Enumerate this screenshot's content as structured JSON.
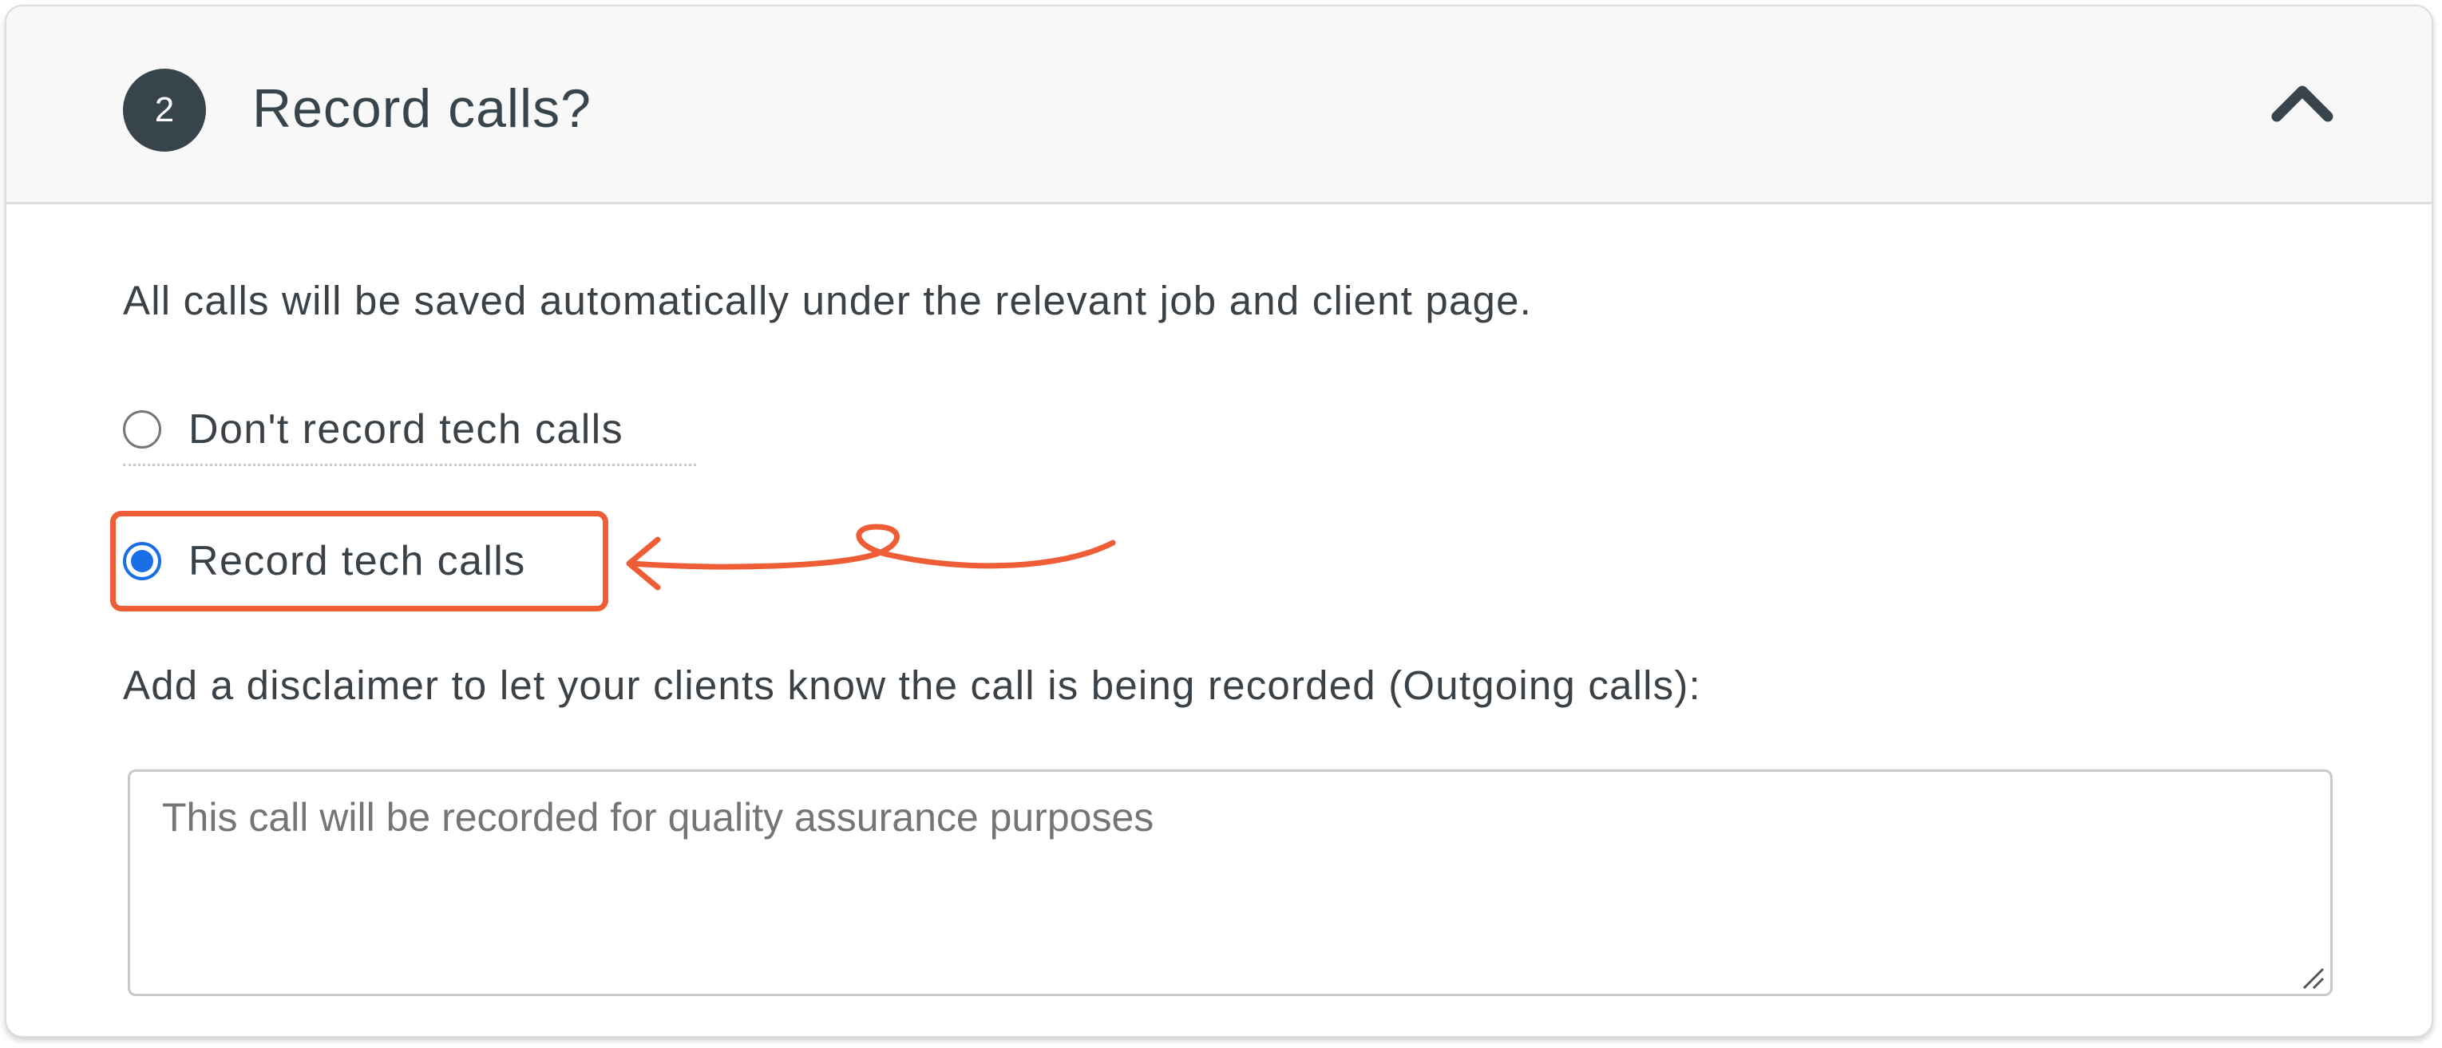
{
  "section": {
    "step_number": "2",
    "title": "Record calls?",
    "expanded": true
  },
  "intro_text": "All calls will be saved automatically under the relevant job and client page.",
  "options": [
    {
      "label": "Don't record tech calls",
      "selected": false
    },
    {
      "label": "Record tech calls",
      "selected": true
    }
  ],
  "disclaimer": {
    "label": "Add a disclaimer to let your clients know the call is being recorded (Outgoing calls):",
    "value": "",
    "placeholder": "This call will be recorded for quality assurance purposes"
  },
  "colors": {
    "badge": "#37444b",
    "radio_selected": "#1a6fe6",
    "annotation": "#ee5d36",
    "header_bg": "#f8f8f8"
  },
  "icons": {
    "collapse": "chevron-up-icon",
    "annotation": "arrow-left-icon"
  }
}
